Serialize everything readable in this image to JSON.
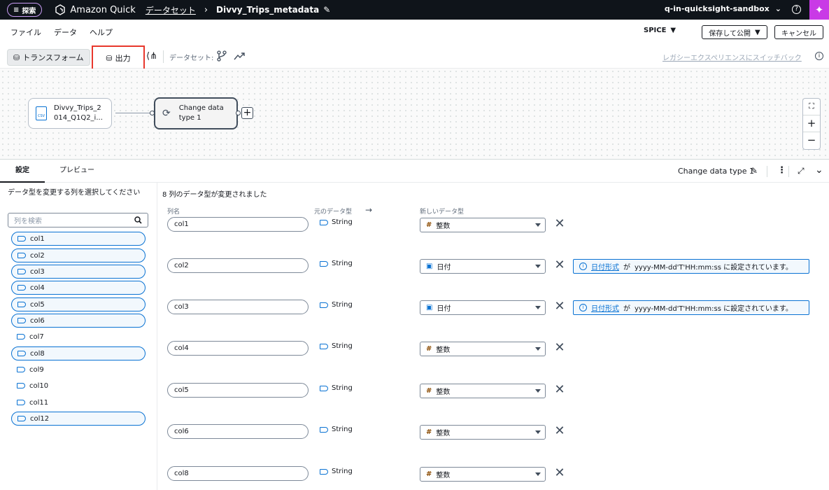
{
  "topbar": {
    "explore_label": "探索",
    "brand": "Amazon Quick",
    "breadcrumb_datasets": "データセット",
    "dataset_title": "Divvy_Trips_metadata",
    "account": "q-in-quicksight-sandbox"
  },
  "menubar": {
    "file": "ファイル",
    "data": "データ",
    "help": "ヘルプ",
    "spice": "SPICE",
    "save_publish": "保存して公開",
    "cancel": "キャンセル"
  },
  "toolbar": {
    "transform": "トランスフォーム",
    "output": "出力",
    "dataset_label": "データセット:",
    "legacy_link": "レガシーエクスペリエンスにスイッチバック"
  },
  "canvas": {
    "source_node_line1": "Divvy_Trips_2",
    "source_node_line2": "014_Q1Q2_i...",
    "source_badge": "CSV",
    "transform_node_line1": "Change data",
    "transform_node_line2": "type 1"
  },
  "tabs": {
    "settings": "設定",
    "preview": "プレビュー",
    "step_name": "Change data type 1"
  },
  "left": {
    "instruction": "データ型を変更する列を選択してください",
    "search_placeholder": "列を検索",
    "columns": [
      {
        "name": "col1",
        "selected": true
      },
      {
        "name": "col2",
        "selected": true
      },
      {
        "name": "col3",
        "selected": true
      },
      {
        "name": "col4",
        "selected": true
      },
      {
        "name": "col5",
        "selected": true
      },
      {
        "name": "col6",
        "selected": true
      },
      {
        "name": "col7",
        "selected": false
      },
      {
        "name": "col8",
        "selected": true
      },
      {
        "name": "col9",
        "selected": false
      },
      {
        "name": "col10",
        "selected": false
      },
      {
        "name": "col11",
        "selected": false
      },
      {
        "name": "col12",
        "selected": true
      }
    ]
  },
  "main": {
    "summary": "8 列のデータ型が変更されました",
    "header_name": "列名",
    "header_orig": "元のデータ型",
    "header_new": "新しいデータ型",
    "rows": [
      {
        "name": "col1",
        "orig": "String",
        "new": "整数",
        "kind": "int",
        "info": false
      },
      {
        "name": "col2",
        "orig": "String",
        "new": "日付",
        "kind": "date",
        "info": true
      },
      {
        "name": "col3",
        "orig": "String",
        "new": "日付",
        "kind": "date",
        "info": true
      },
      {
        "name": "col4",
        "orig": "String",
        "new": "整数",
        "kind": "int",
        "info": false
      },
      {
        "name": "col5",
        "orig": "String",
        "new": "整数",
        "kind": "int",
        "info": false
      },
      {
        "name": "col6",
        "orig": "String",
        "new": "整数",
        "kind": "int",
        "info": false
      },
      {
        "name": "col8",
        "orig": "String",
        "new": "整数",
        "kind": "int",
        "info": false
      }
    ],
    "info_link": "日付形式",
    "info_ga": "が",
    "info_text": "yyyy-MM-dd'T'HH:mm:ss に設定されています。"
  },
  "colors": {
    "accent": "#0972d3",
    "highlight": "#e8372c",
    "topbar": "#0f141a",
    "q_button": "#c93ae6"
  }
}
